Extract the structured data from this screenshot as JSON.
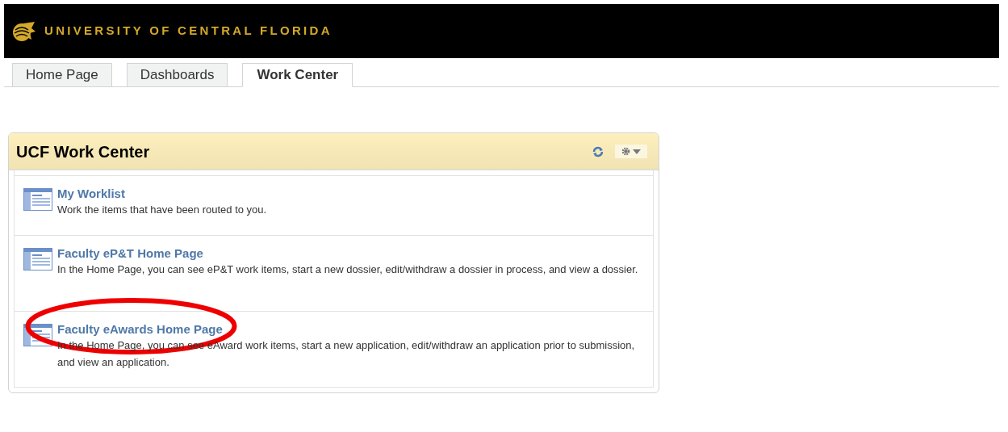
{
  "header": {
    "title": "UNIVERSITY OF CENTRAL FLORIDA"
  },
  "tabs": [
    {
      "label": "Home Page",
      "selected": false
    },
    {
      "label": "Dashboards",
      "selected": false
    },
    {
      "label": "Work Center",
      "selected": true
    }
  ],
  "panel": {
    "title": "UCF Work Center",
    "items": [
      {
        "title": "My Worklist",
        "description": "Work the items that have been routed to you.",
        "highlighted": false
      },
      {
        "title": "Faculty eP&T Home Page",
        "description": "In the Home Page, you can see eP&T work items, start a new dossier, edit/withdraw a dossier in process, and view a dossier.",
        "highlighted": false
      },
      {
        "title": "Faculty eAwards Home Page",
        "description": "In the Home Page, you can see eAward work items, start a new application, edit/withdraw an application prior to submission, and view an application.",
        "highlighted": true
      }
    ]
  }
}
